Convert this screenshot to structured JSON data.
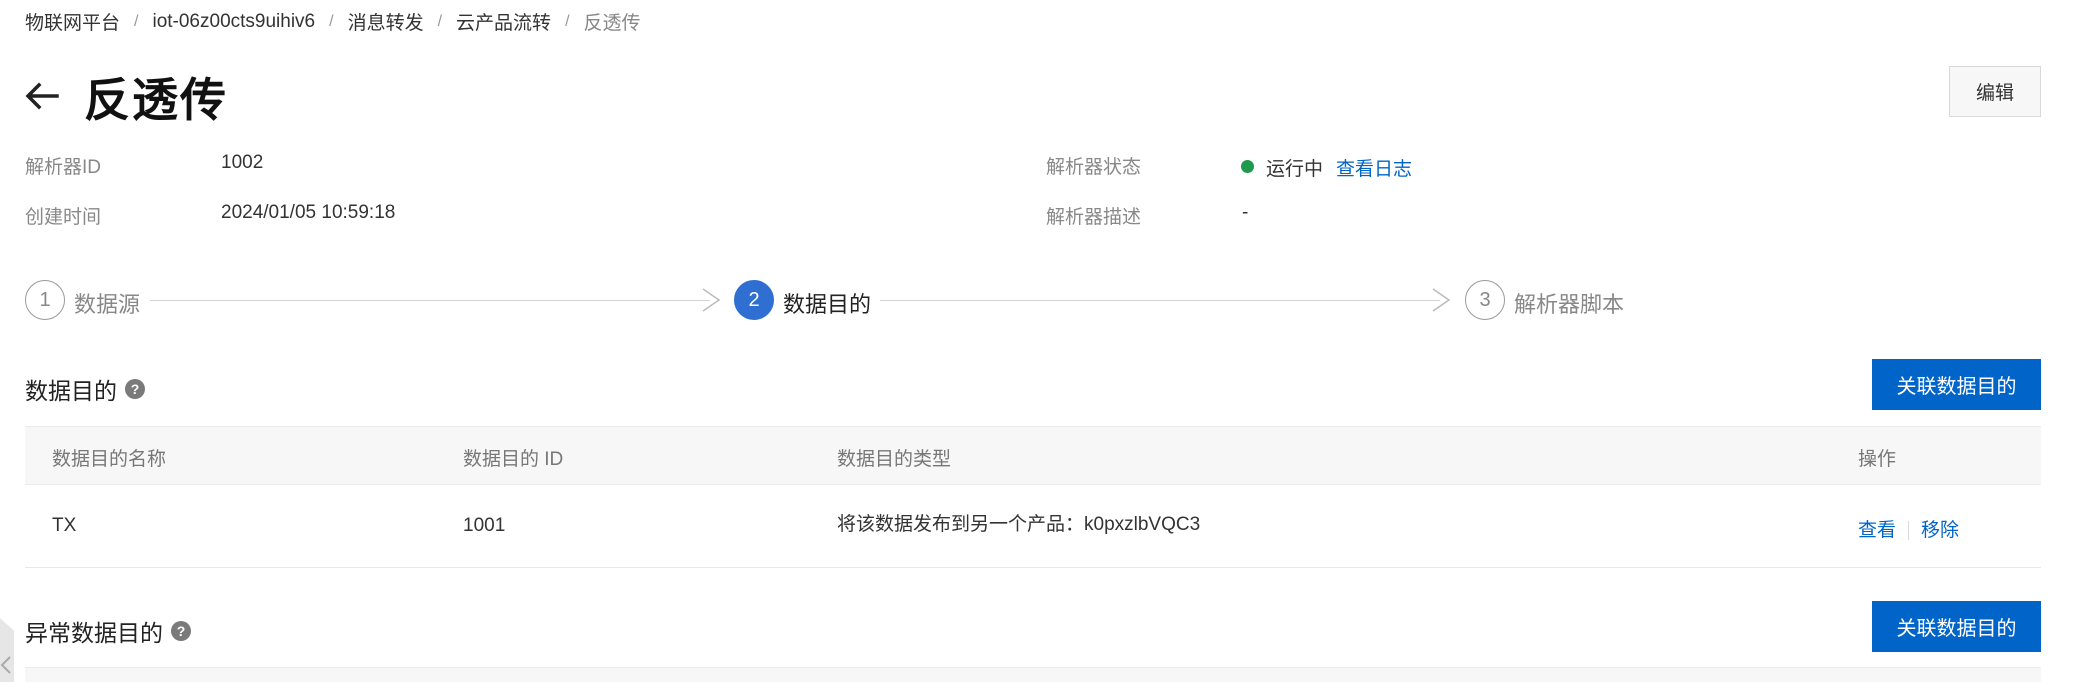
{
  "breadcrumb": [
    {
      "label": "物联网平台"
    },
    {
      "label": "iot-06z00cts9uihiv6"
    },
    {
      "label": "消息转发"
    },
    {
      "label": "云产品流转"
    },
    {
      "label": "反透传"
    }
  ],
  "breadcrumb_separator": "/",
  "page_title": "反透传",
  "edit_button": "编辑",
  "info": {
    "parser_id_label": "解析器ID",
    "parser_id_value": "1002",
    "created_label": "创建时间",
    "created_value": "2024/01/05 10:59:18",
    "status_label": "解析器状态",
    "status_value": "运行中",
    "view_log": "查看日志",
    "desc_label": "解析器描述",
    "desc_value": "-",
    "status_color": "#1e9a4c"
  },
  "steps": [
    {
      "number": "1",
      "label": "数据源",
      "active": false
    },
    {
      "number": "2",
      "label": "数据目的",
      "active": true
    },
    {
      "number": "3",
      "label": "解析器脚本",
      "active": false
    }
  ],
  "destination_section": {
    "title": "数据目的",
    "help": "?",
    "button": "关联数据目的"
  },
  "table": {
    "columns": [
      "数据目的名称",
      "数据目的 ID",
      "数据目的类型",
      "操作"
    ],
    "rows": [
      {
        "name": "TX",
        "id": "1001",
        "type": "将该数据发布到另一个产品：k0pxzlbVQC3",
        "actions": [
          "查看",
          "移除"
        ]
      }
    ]
  },
  "error_section": {
    "title": "异常数据目的",
    "help": "?",
    "button": "关联数据目的"
  },
  "colors": {
    "primary": "#0064c8",
    "step_active": "#2f6fd1",
    "running": "#1e9a4c"
  },
  "icons": {
    "back": "arrow-left-icon",
    "help": "question-circle-icon",
    "step_arrow": "chevron-right-icon",
    "collapse": "chevron-left-icon"
  }
}
